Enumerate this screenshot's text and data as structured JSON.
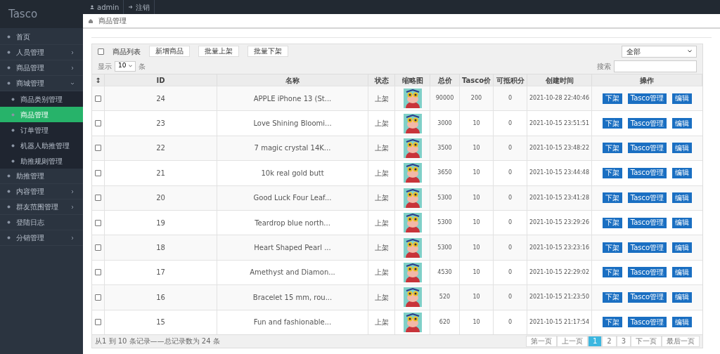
{
  "brand": "Tasco",
  "topbar": [
    {
      "kind": "user",
      "label": "admin"
    },
    {
      "kind": "logout",
      "label": "注销"
    }
  ],
  "sidebar": {
    "items": [
      {
        "label": "首页",
        "selected": false
      },
      {
        "label": "人员管理",
        "selected": false,
        "expanded": false
      },
      {
        "label": "商品管理",
        "selected": false,
        "expanded": false
      },
      {
        "label": "商城管理",
        "selected": false,
        "expanded": true,
        "children": [
          {
            "label": "商品类别管理",
            "selected": false
          },
          {
            "label": "商品管理",
            "selected": true
          },
          {
            "label": "订单管理",
            "selected": false
          },
          {
            "label": "机器人助推管理",
            "selected": false
          },
          {
            "label": "助推规则管理",
            "selected": false
          }
        ]
      },
      {
        "label": "助推管理",
        "selected": false
      },
      {
        "label": "内容管理",
        "selected": false,
        "expanded": false
      },
      {
        "label": "群友范围管理",
        "selected": false,
        "expanded": false
      },
      {
        "label": "登陆日志",
        "selected": false
      },
      {
        "label": "分销管理",
        "selected": false,
        "expanded": false
      }
    ]
  },
  "breadcrumb": "商品管理",
  "toolbar": {
    "title": "商品列表",
    "buttons": [
      "新增商品",
      "批量上架",
      "批量下架"
    ],
    "filter": "全部"
  },
  "page_size": {
    "prefix": "显示",
    "value": "10",
    "suffix": "条"
  },
  "search": {
    "label": "搜索"
  },
  "table": {
    "columns": [
      "↕",
      "ID",
      "名称",
      "状态",
      "缩略图",
      "总价",
      "Tasco价",
      "可抵积分",
      "创建时间",
      "操作"
    ],
    "rows": [
      {
        "checked": false,
        "id": "24",
        "name": "APPLE iPhone 13 (St...",
        "status": "上架",
        "total": "90000",
        "tasco": "200",
        "points": "0",
        "created": "2021-10-28 22:40:46",
        "actions": [
          "下架",
          "Tasco管理",
          "编辑"
        ]
      },
      {
        "checked": false,
        "id": "23",
        "name": "Love Shining Bloomi...",
        "status": "上架",
        "total": "3000",
        "tasco": "10",
        "points": "0",
        "created": "2021-10-15 23:51:51",
        "actions": [
          "下架",
          "Tasco管理",
          "编辑"
        ]
      },
      {
        "checked": false,
        "id": "22",
        "name": "7 magic crystal 14K...",
        "status": "上架",
        "total": "3500",
        "tasco": "10",
        "points": "0",
        "created": "2021-10-15 23:48:22",
        "actions": [
          "下架",
          "Tasco管理",
          "编辑"
        ]
      },
      {
        "checked": false,
        "id": "21",
        "name": "10k real gold butt",
        "status": "上架",
        "total": "3650",
        "tasco": "10",
        "points": "0",
        "created": "2021-10-15 23:44:48",
        "actions": [
          "下架",
          "Tasco管理",
          "编辑"
        ]
      },
      {
        "checked": false,
        "id": "20",
        "name": "Good Luck Four Leaf...",
        "status": "上架",
        "total": "5300",
        "tasco": "10",
        "points": "0",
        "created": "2021-10-15 23:41:28",
        "actions": [
          "下架",
          "Tasco管理",
          "编辑"
        ]
      },
      {
        "checked": false,
        "id": "19",
        "name": "Teardrop blue north...",
        "status": "上架",
        "total": "5300",
        "tasco": "10",
        "points": "0",
        "created": "2021-10-15 23:29:26",
        "actions": [
          "下架",
          "Tasco管理",
          "编辑"
        ]
      },
      {
        "checked": false,
        "id": "18",
        "name": "Heart Shaped Pearl ...",
        "status": "上架",
        "total": "5300",
        "tasco": "10",
        "points": "0",
        "created": "2021-10-15 23:23:16",
        "actions": [
          "下架",
          "Tasco管理",
          "编辑"
        ]
      },
      {
        "checked": false,
        "id": "17",
        "name": "Amethyst and Diamon...",
        "status": "上架",
        "total": "4530",
        "tasco": "10",
        "points": "0",
        "created": "2021-10-15 22:29:02",
        "actions": [
          "下架",
          "Tasco管理",
          "编辑"
        ]
      },
      {
        "checked": false,
        "id": "16",
        "name": "Bracelet 15 mm, rou...",
        "status": "上架",
        "total": "520",
        "tasco": "10",
        "points": "0",
        "created": "2021-10-15 21:23:50",
        "actions": [
          "下架",
          "Tasco管理",
          "编辑"
        ]
      },
      {
        "checked": false,
        "id": "15",
        "name": "Fun and fashionable...",
        "status": "上架",
        "total": "620",
        "tasco": "10",
        "points": "0",
        "created": "2021-10-15 21:17:54",
        "actions": [
          "下架",
          "Tasco管理",
          "编辑"
        ]
      }
    ]
  },
  "footer": "从1 到 10 条记录——总记录数为 24 条",
  "pagination": [
    {
      "label": "第一页",
      "selected": false
    },
    {
      "label": "上一页",
      "selected": false
    },
    {
      "label": "1",
      "selected": true
    },
    {
      "label": "2",
      "selected": false
    },
    {
      "label": "3",
      "selected": false
    },
    {
      "label": "下一页",
      "selected": false
    },
    {
      "label": "最后一页",
      "selected": false
    }
  ]
}
